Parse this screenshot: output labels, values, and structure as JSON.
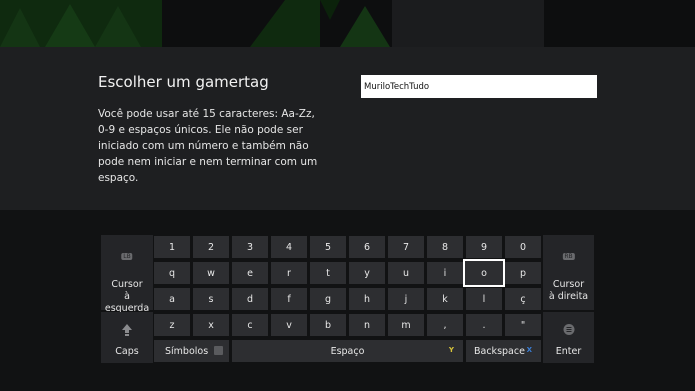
{
  "dialog": {
    "title": "Escolher um gamertag",
    "description": "Você pode usar até 15 caracteres: Aa-Zz, 0-9 e espaços únicos. Ele não pode ser iniciado com um número e também não pode nem iniciar e nem terminar com um espaço.",
    "input_value": "MuriloTechTudo"
  },
  "keyboard": {
    "row1": [
      "1",
      "2",
      "3",
      "4",
      "5",
      "6",
      "7",
      "8",
      "9",
      "0"
    ],
    "row2": [
      "q",
      "w",
      "e",
      "r",
      "t",
      "y",
      "u",
      "i",
      "o",
      "p"
    ],
    "row3": [
      "a",
      "s",
      "d",
      "f",
      "g",
      "h",
      "j",
      "k",
      "l",
      "ç"
    ],
    "row4": [
      "z",
      "x",
      "c",
      "v",
      "b",
      "n",
      "m",
      ",",
      ".",
      "\""
    ],
    "selected_key": "o",
    "cursor_left": {
      "line1": "Cursor",
      "line2": "à esquerda",
      "badge": "LB"
    },
    "cursor_right": {
      "line1": "Cursor",
      "line2": "à direita",
      "badge": "RB"
    },
    "caps": "Caps",
    "symbols": "Símbolos",
    "space": "Espaço",
    "space_button": "Y",
    "backspace": "Backspace",
    "backspace_button": "X",
    "enter": "Enter"
  },
  "colors": {
    "y_button": "#d8c53a",
    "x_button": "#3a7fd8"
  }
}
